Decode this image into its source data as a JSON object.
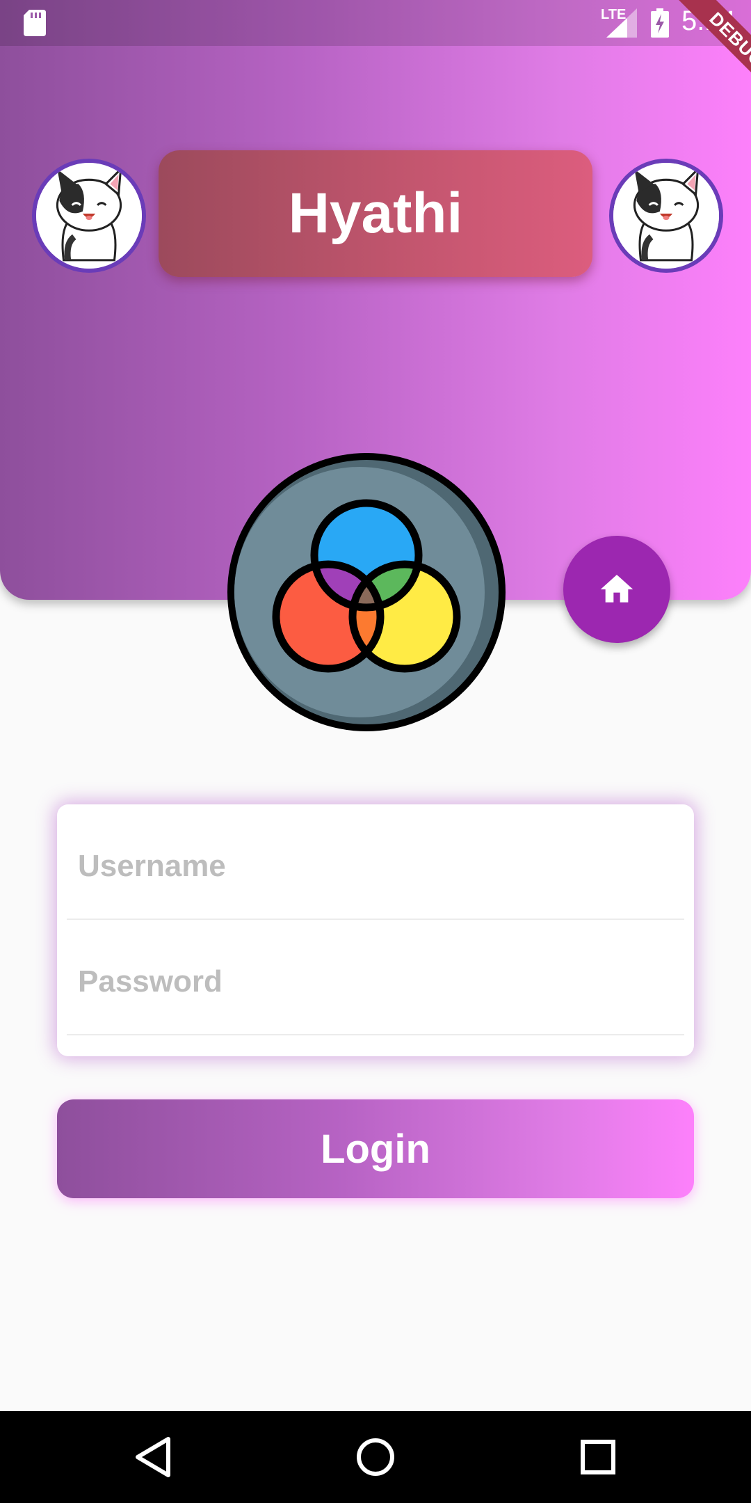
{
  "status_bar": {
    "network": "LTE",
    "time": "5:14",
    "icons": [
      "sd-card-icon",
      "signal-icon",
      "battery-charging-icon"
    ]
  },
  "debug_banner": {
    "label": "DEBUG"
  },
  "header": {
    "title": "Hyathi",
    "left_avatar_icon": "cat-avatar-icon",
    "right_avatar_icon": "cat-avatar-icon",
    "logo_icon": "color-circles-logo-icon",
    "fab_icon": "home-icon"
  },
  "form": {
    "username": {
      "value": "",
      "placeholder": "Username"
    },
    "password": {
      "value": "",
      "placeholder": "Password"
    }
  },
  "login_button": {
    "label": "Login"
  },
  "nav_bar": {
    "icons": [
      "back-icon",
      "home-circle-icon",
      "recents-icon"
    ]
  },
  "colors": {
    "gradient_start": "#8e4f9c",
    "gradient_end": "#fd80fb",
    "title_box": "#c4566f",
    "fab": "#9c27b0",
    "avatar_border": "#6a3cb8",
    "logo_bg": "#708c99",
    "logo_blue": "#29a8f5",
    "logo_red": "#fc5c42",
    "logo_yellow": "#ffeb45",
    "logo_purple": "#a040b8",
    "logo_green": "#5cb85c"
  }
}
